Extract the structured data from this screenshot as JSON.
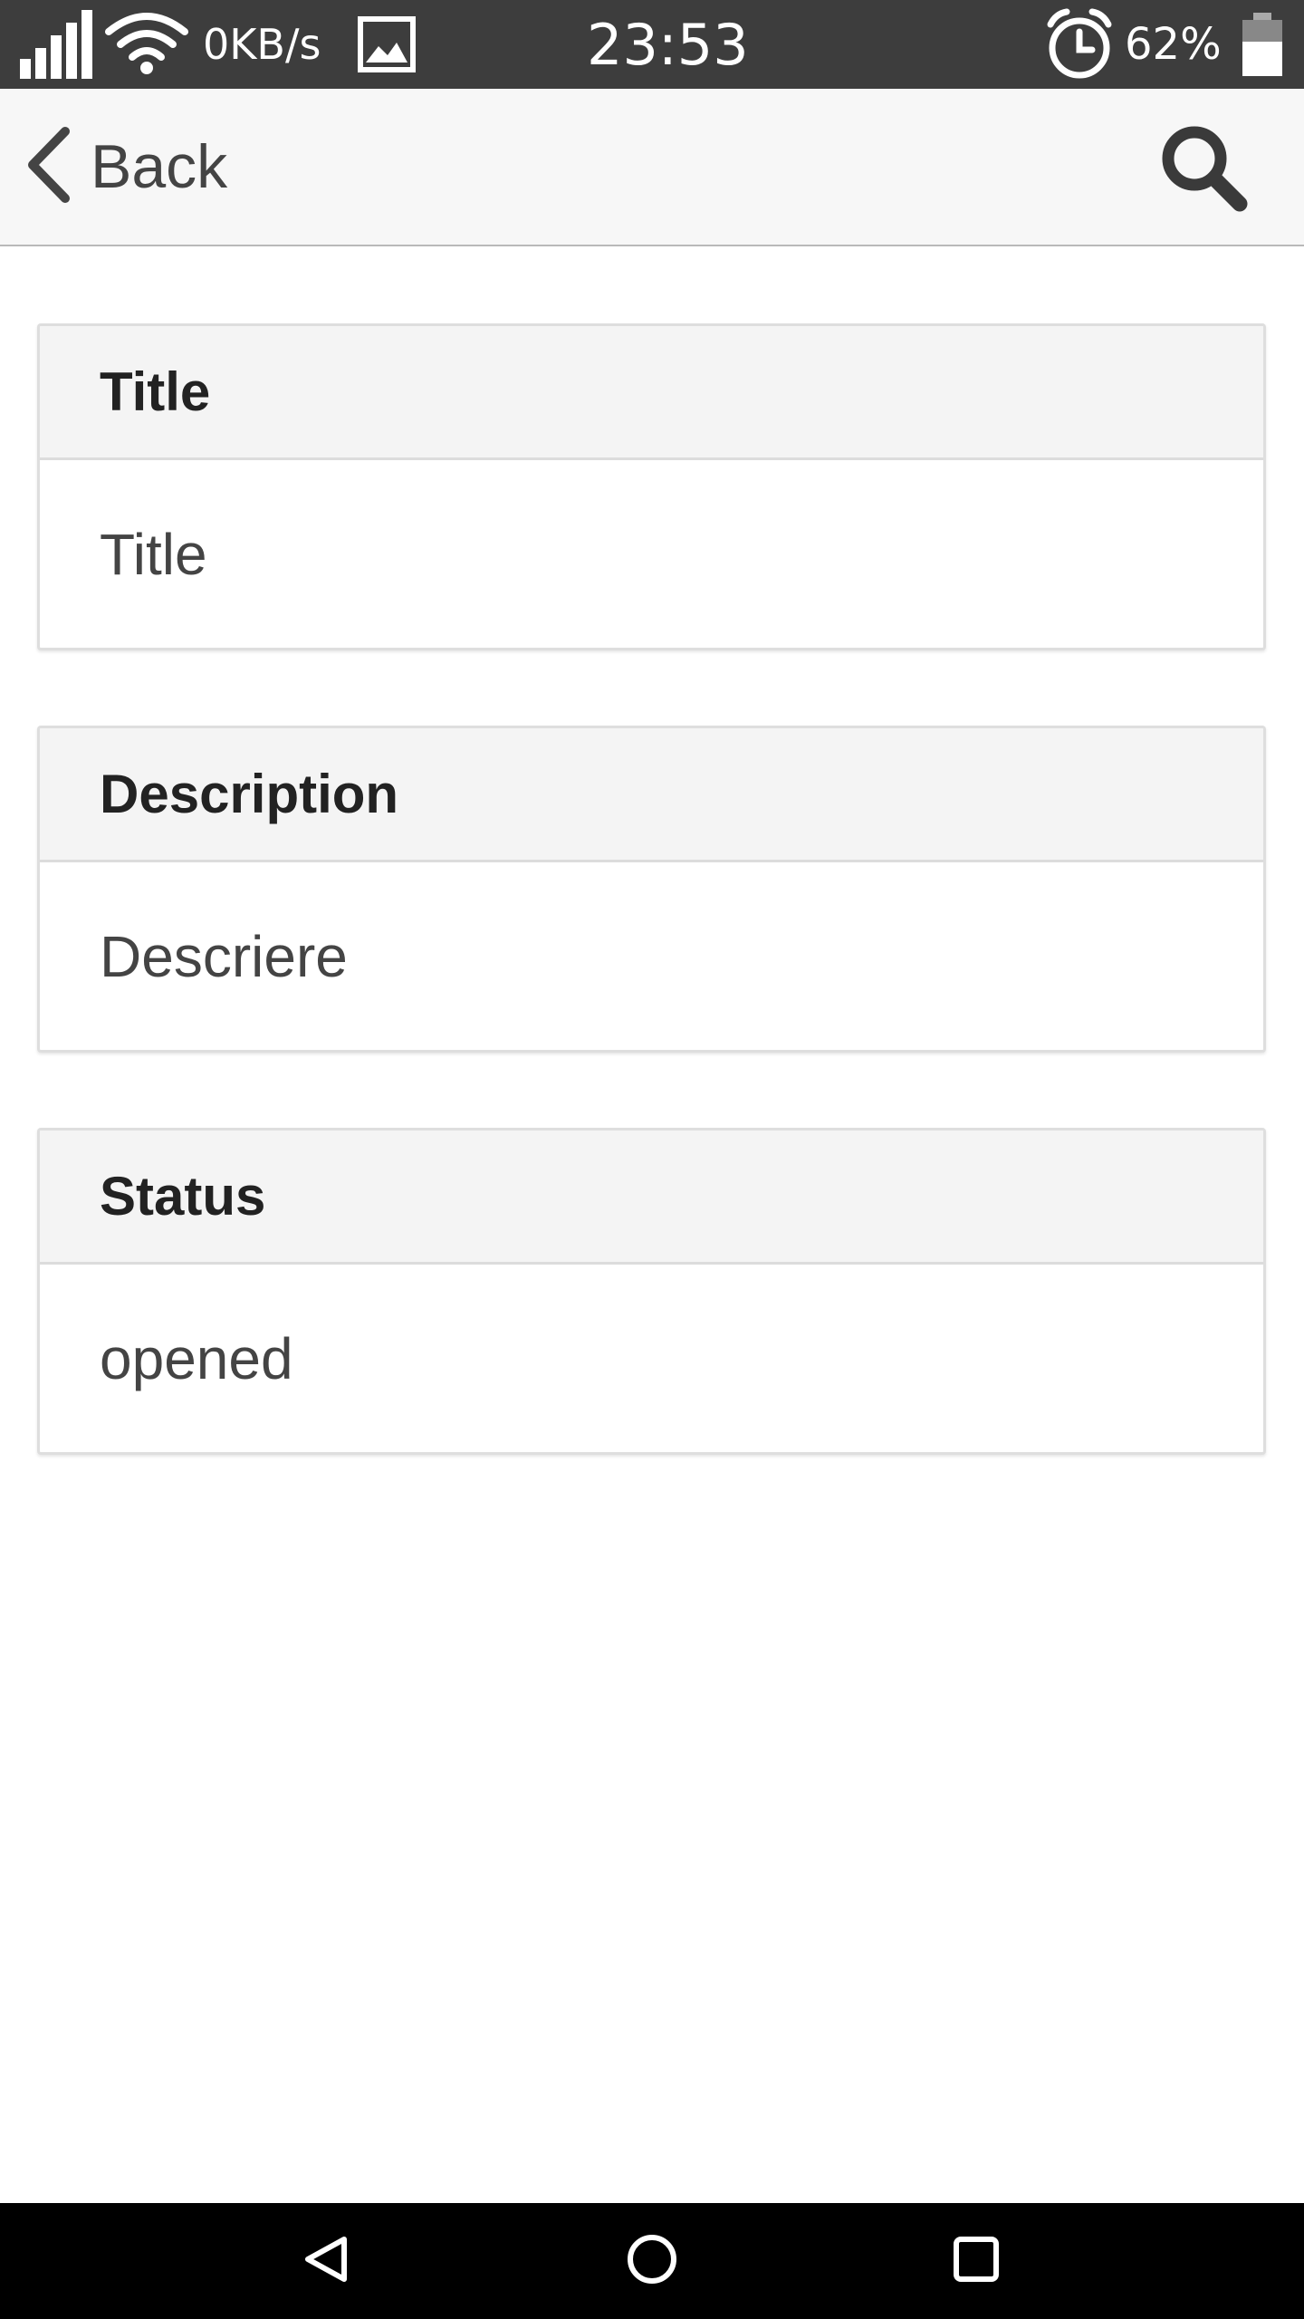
{
  "status_bar": {
    "net_speed": "0KB/s",
    "time": "23:53",
    "battery_percent": "62%",
    "battery_level": 0.62,
    "icons": [
      "signal-icon",
      "wifi-icon",
      "image-notification-icon",
      "alarm-icon",
      "battery-icon"
    ]
  },
  "header": {
    "back_label": "Back",
    "icons": [
      "chevron-left-icon",
      "search-icon"
    ]
  },
  "cards": [
    {
      "header": "Title",
      "value": "Title"
    },
    {
      "header": "Description",
      "value": "Descriere"
    },
    {
      "header": "Status",
      "value": "opened"
    }
  ],
  "nav_bar": {
    "icons": [
      "back-triangle-icon",
      "home-circle-icon",
      "recents-square-icon"
    ]
  },
  "colors": {
    "status_bar_bg": "#3d3d3d",
    "header_bg": "#f7f7f7",
    "card_header_bg": "#f4f4f4",
    "nav_bar_bg": "#000000"
  }
}
